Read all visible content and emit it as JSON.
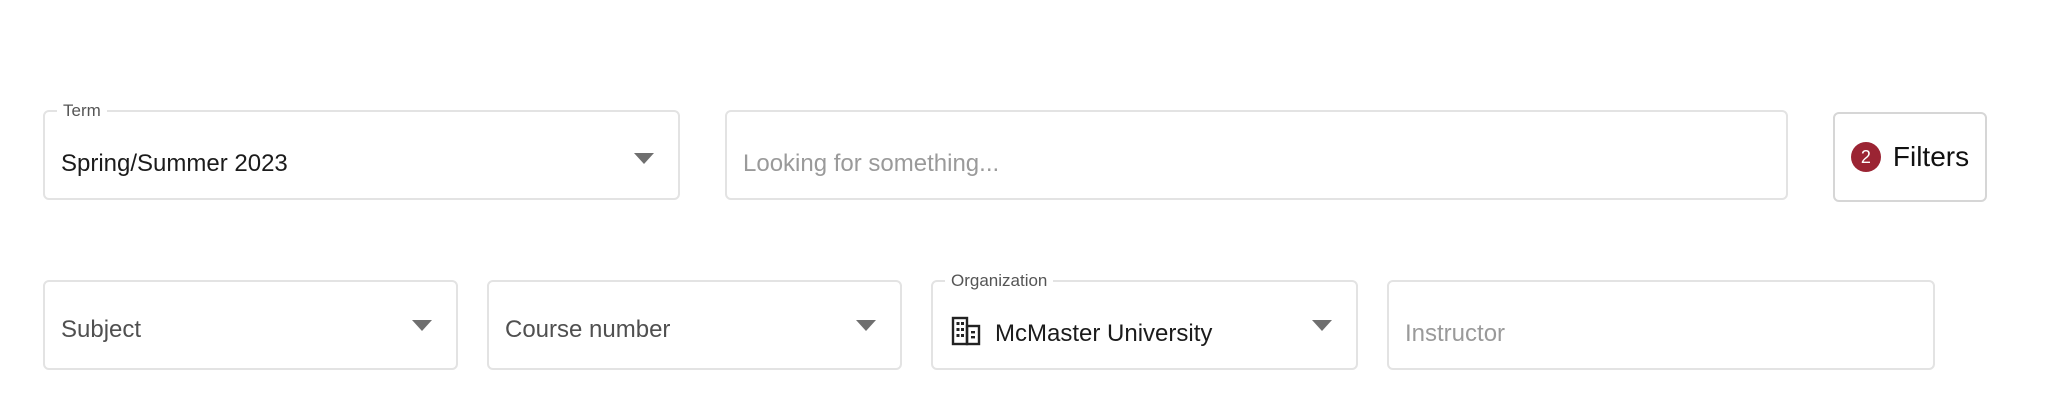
{
  "term": {
    "legend": "Term",
    "value": "Spring/Summer 2023"
  },
  "search": {
    "placeholder": "Looking for something..."
  },
  "filters": {
    "count": "2",
    "label": "Filters",
    "badge_color": "#9b2433"
  },
  "subject": {
    "placeholder": "Subject"
  },
  "course_number": {
    "placeholder": "Course number"
  },
  "organization": {
    "legend": "Organization",
    "value": "McMaster University",
    "icon": "building-icon"
  },
  "instructor": {
    "placeholder": "Instructor"
  }
}
